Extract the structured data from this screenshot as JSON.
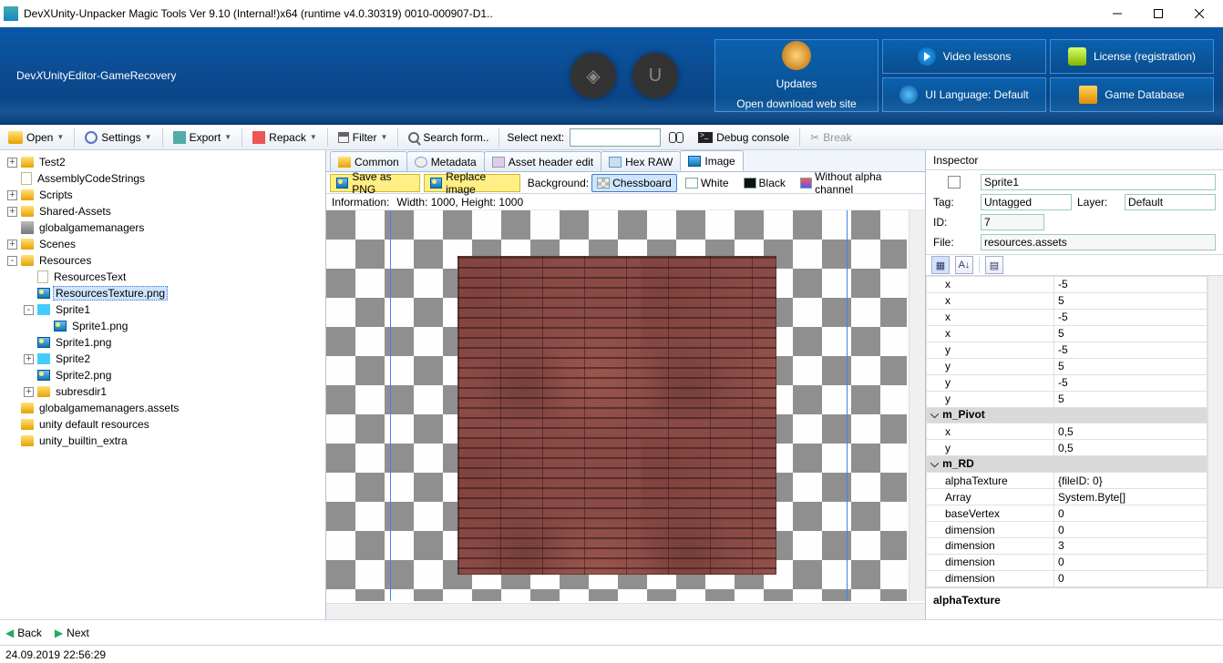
{
  "title": "DevXUnity-Unpacker Magic Tools Ver 9.10 (Internal!)x64 (runtime v4.0.30319) 0010-000907-D1..",
  "logo_parts": {
    "a": "Dev",
    "b": "X",
    "c": "UnityEditor-GameRecovery"
  },
  "header": {
    "video": "Video lessons",
    "license": "License (registration)",
    "lang": "UI Language: Default",
    "db": "Game Database",
    "updates_line1": "Updates",
    "updates_line2": "Open download web site"
  },
  "toolbar": {
    "open": "Open",
    "settings": "Settings",
    "export": "Export",
    "repack": "Repack",
    "filter": "Filter",
    "searchform": "Search form..",
    "selectnext": "Select next:",
    "debug": "Debug console",
    "break": "Break"
  },
  "tree": [
    {
      "d": 0,
      "e": "+",
      "i": "f",
      "t": "Test2"
    },
    {
      "d": 0,
      "e": " ",
      "i": "txt",
      "t": "AssemblyCodeStrings"
    },
    {
      "d": 0,
      "e": "+",
      "i": "f",
      "t": "Scripts"
    },
    {
      "d": 0,
      "e": "+",
      "i": "f",
      "t": "Shared-Assets"
    },
    {
      "d": 0,
      "e": " ",
      "i": "cube",
      "t": "globalgamemanagers"
    },
    {
      "d": 0,
      "e": "+",
      "i": "f",
      "t": "Scenes"
    },
    {
      "d": 0,
      "e": "-",
      "i": "f",
      "t": "Resources"
    },
    {
      "d": 1,
      "e": " ",
      "i": "txt",
      "t": "ResourcesText",
      "sel": false
    },
    {
      "d": 1,
      "e": " ",
      "i": "img",
      "t": "ResourcesTexture.png",
      "sel": true
    },
    {
      "d": 1,
      "e": "-",
      "i": "butter",
      "t": "Sprite1"
    },
    {
      "d": 2,
      "e": " ",
      "i": "img",
      "t": "Sprite1.png"
    },
    {
      "d": 1,
      "e": " ",
      "i": "img",
      "t": "Sprite1.png"
    },
    {
      "d": 1,
      "e": "+",
      "i": "butter",
      "t": "Sprite2"
    },
    {
      "d": 1,
      "e": " ",
      "i": "img",
      "t": "Sprite2.png"
    },
    {
      "d": 1,
      "e": "+",
      "i": "f",
      "t": "subresdir1"
    },
    {
      "d": 0,
      "e": " ",
      "i": "f",
      "t": "globalgamemanagers.assets"
    },
    {
      "d": 0,
      "e": " ",
      "i": "f",
      "t": "unity default resources"
    },
    {
      "d": 0,
      "e": " ",
      "i": "f",
      "t": "unity_builtin_extra"
    }
  ],
  "back": "Back",
  "next": "Next",
  "tabs": {
    "common": "Common",
    "metadata": "Metadata",
    "header": "Asset header edit",
    "hex": "Hex RAW",
    "image": "Image"
  },
  "viewer": {
    "save": "Save as PNG",
    "replace": "Replace image",
    "bg_label": "Background:",
    "chess": "Chessboard",
    "white": "White",
    "black": "Black",
    "noalpha": "Without alpha channel",
    "info_label": "Information:",
    "info_val": "Width: 1000, Height: 1000"
  },
  "inspector": {
    "title": "Inspector",
    "name": "Sprite1",
    "tag_l": "Tag:",
    "tag_v": "Untagged",
    "layer_l": "Layer:",
    "layer_v": "Default",
    "id_l": "ID:",
    "id_v": "7",
    "file_l": "File:",
    "file_v": "resources.assets",
    "props": [
      {
        "c": false,
        "k": "x",
        "v": "-5"
      },
      {
        "c": false,
        "k": "x",
        "v": "5"
      },
      {
        "c": false,
        "k": "x",
        "v": "-5"
      },
      {
        "c": false,
        "k": "x",
        "v": "5"
      },
      {
        "c": false,
        "k": "y",
        "v": "-5"
      },
      {
        "c": false,
        "k": "y",
        "v": "5"
      },
      {
        "c": false,
        "k": "y",
        "v": "-5"
      },
      {
        "c": false,
        "k": "y",
        "v": "5"
      },
      {
        "c": true,
        "k": "m_Pivot",
        "v": ""
      },
      {
        "c": false,
        "k": "x",
        "v": "0,5"
      },
      {
        "c": false,
        "k": "y",
        "v": "0,5"
      },
      {
        "c": true,
        "k": "m_RD",
        "v": ""
      },
      {
        "c": false,
        "k": "alphaTexture",
        "v": "{fileID: 0}"
      },
      {
        "c": false,
        "k": "Array",
        "v": "System.Byte[]"
      },
      {
        "c": false,
        "k": "baseVertex",
        "v": "0"
      },
      {
        "c": false,
        "k": "dimension",
        "v": "0"
      },
      {
        "c": false,
        "k": "dimension",
        "v": "3"
      },
      {
        "c": false,
        "k": "dimension",
        "v": "0"
      },
      {
        "c": false,
        "k": "dimension",
        "v": "0"
      }
    ],
    "footer": "alphaTexture"
  },
  "status": "24.09.2019 22:56:29"
}
